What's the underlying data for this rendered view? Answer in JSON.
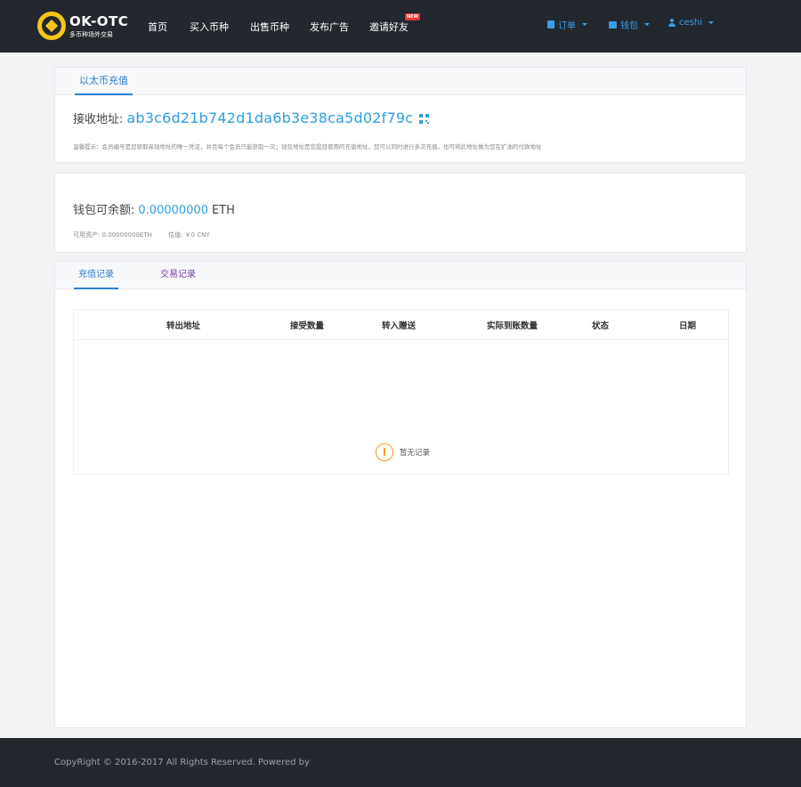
{
  "brand": {
    "name": "OK-OTC",
    "tagline": "多币种场外交易",
    "accent": "#f5c518"
  },
  "nav": {
    "items": [
      "首页",
      "买入币种",
      "出售币种",
      "发布广告",
      "邀请好友"
    ],
    "new_badge": "NEW"
  },
  "user_nav": {
    "orders": "订单",
    "wallet": "钱包",
    "user": "ceshi"
  },
  "recharge": {
    "tab": "以太币充值",
    "address_label": "接收地址:",
    "address": "ab3c6d21b742d1da6b3e38ca5d02f79c",
    "tip": "温馨提示：会员编号是您获取高钱地址的唯一凭证，并且每个会员只能获取一次；钱包地址是您提目使用的充值地址，您可以同时进行多次充值，也可将此地址做为您在扩池的付款地址"
  },
  "balance": {
    "label": "钱包可余额:",
    "value": "0.00000000",
    "unit": "ETH",
    "available": "可用资产: 0.00000000ETH",
    "valuation": "估值: ￥0 CNY"
  },
  "records": {
    "tabs": [
      "充值记录",
      "交易记录"
    ],
    "columns": [
      "转出地址",
      "接受数量",
      "转入赠送",
      "实际到账数量",
      "状态",
      "日期"
    ],
    "empty": "暂无记录"
  },
  "footer": {
    "copyright": "CopyRight © 2016-2017 All Rights Reserved. Powered by"
  },
  "colors": {
    "header_bg": "#23272e",
    "link_blue": "#2d9ee0",
    "tab_blue": "#2d7fd3"
  }
}
